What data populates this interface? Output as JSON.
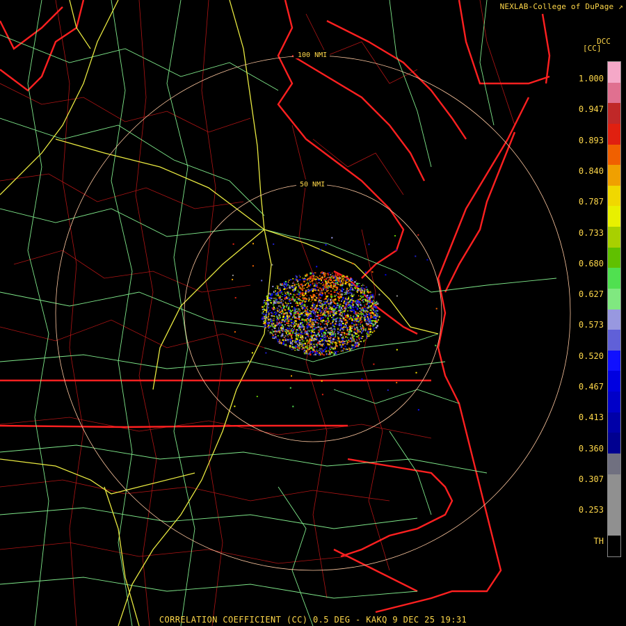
{
  "credit": "NEXLAB-College of DuPage",
  "product_code": "DCC",
  "unit": "[CC]",
  "range_rings": [
    {
      "label": "100 NMI"
    },
    {
      "label": "50 NMI"
    }
  ],
  "colorbar": {
    "labels": [
      "1.000",
      "0.947",
      "0.893",
      "0.840",
      "0.787",
      "0.733",
      "0.680",
      "0.627",
      "0.573",
      "0.520",
      "0.467",
      "0.413",
      "0.360",
      "0.307",
      "0.253",
      "TH"
    ],
    "segments": [
      {
        "color": "#f5a8c8"
      },
      {
        "color": "#e07090"
      },
      {
        "color": "#c02828"
      },
      {
        "color": "#e02010"
      },
      {
        "color": "#f06000"
      },
      {
        "color": "#f0a000"
      },
      {
        "color": "#f0d800"
      },
      {
        "color": "#e8f000"
      },
      {
        "color": "#a8d000"
      },
      {
        "color": "#60c000"
      },
      {
        "color": "#50e050"
      },
      {
        "color": "#80e880"
      },
      {
        "color": "#9898e0"
      },
      {
        "color": "#6060d8"
      },
      {
        "color": "#1010ff"
      },
      {
        "color": "#0000e0"
      },
      {
        "color": "#0000c8"
      },
      {
        "color": "#0000a8"
      },
      {
        "color": "#000090"
      },
      {
        "color": "#707080"
      },
      {
        "color": "#909090"
      },
      {
        "color": "#909090"
      },
      {
        "color": "#909090"
      },
      {
        "color": "#000000"
      }
    ]
  },
  "status_line": "CORRELATION COEFFICIENT (CC) 0.5 DEG - KAKQ 9 DEC 25 19:31",
  "colors": {
    "state_border": "#ff2020",
    "county_line": "#c01818",
    "roads_green": "#7fe88a",
    "roads_yellow": "#e8e840",
    "range_ring": "#ffc8a0",
    "text": "#ffd84a"
  }
}
